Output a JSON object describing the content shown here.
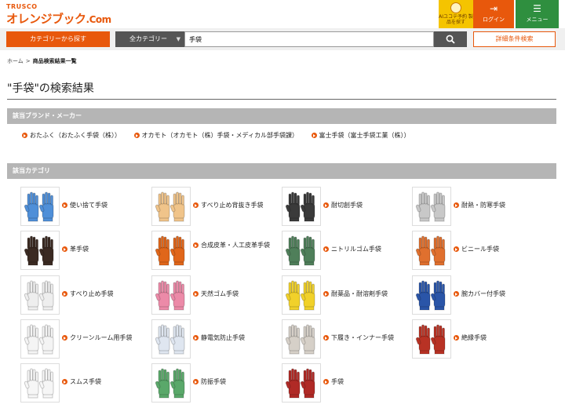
{
  "header": {
    "logo_small": "TRUSCO",
    "logo_main": "オレンジブック",
    "logo_dotcom": ".Com",
    "ai_label": "AIユコテ予約 製品を探す",
    "login_label": "ログイン",
    "menu_label": "メニュー"
  },
  "search": {
    "category_button": "カテゴリーから探す",
    "all_category": "全カテゴリー",
    "query": "手袋",
    "detail_button": "詳細条件検索"
  },
  "breadcrumb": {
    "home": "ホーム",
    "separator": ">",
    "current": "商品検索結果一覧"
  },
  "page_title": "\"手袋\"の検索結果",
  "brand_section": {
    "heading": "該当ブランド・メーカー",
    "items": [
      "おたふく（おたふく手袋（株））",
      "オカモト（オカモト（株）手袋・メディカル部手袋課）",
      "富士手袋（富士手袋工業（株））"
    ]
  },
  "category_section": {
    "heading": "該当カテゴリ",
    "items": [
      {
        "label": "使い捨て手袋",
        "color": "#4f8fd8"
      },
      {
        "label": "すべり止め背抜き手袋",
        "color": "#f0c48a"
      },
      {
        "label": "耐切創手袋",
        "color": "#3a3a3a"
      },
      {
        "label": "耐熱・防寒手袋",
        "color": "#c8c8c8"
      },
      {
        "label": "革手袋",
        "color": "#3b2a22"
      },
      {
        "label": "合成皮革・人工皮革手袋",
        "color": "#e0661a"
      },
      {
        "label": "ニトリルゴム手袋",
        "color": "#4f7f5a"
      },
      {
        "label": "ビニール手袋",
        "color": "#e0702e"
      },
      {
        "label": "すべり止め手袋",
        "color": "#eeeeee"
      },
      {
        "label": "天然ゴム手袋",
        "color": "#ec8aa8"
      },
      {
        "label": "耐薬品・耐溶剤手袋",
        "color": "#f1d12a"
      },
      {
        "label": "腕カバー付手袋",
        "color": "#2a55a8"
      },
      {
        "label": "クリーンルーム用手袋",
        "color": "#f4f4f4"
      },
      {
        "label": "静電気防止手袋",
        "color": "#dfe6f0"
      },
      {
        "label": "下履き・インナー手袋",
        "color": "#d6d0c8"
      },
      {
        "label": "絶縁手袋",
        "color": "#b83224"
      },
      {
        "label": "スムス手袋",
        "color": "#f6f6f6"
      },
      {
        "label": "防振手袋",
        "color": "#5aa86a"
      },
      {
        "label": "手袋",
        "color": "#b02a26"
      }
    ]
  },
  "colors": {
    "brand_orange": "#e8580c",
    "section_gray": "#b5b5b5",
    "menu_green": "#2f8f3f",
    "ai_yellow": "#f5c400"
  },
  "icons": [
    "ai-assistant-icon",
    "login-icon",
    "menu-icon",
    "search-icon",
    "bullet-arrow-icon"
  ]
}
